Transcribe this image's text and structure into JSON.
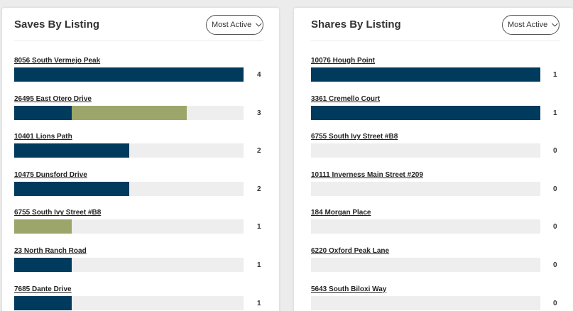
{
  "colors": {
    "primary": "#003a5d",
    "secondary": "#9ca66a",
    "track": "#eeeeee"
  },
  "saves": {
    "title": "Saves By Listing",
    "dropdown": "Most Active",
    "max": 4,
    "items": [
      {
        "label": "8056 South Vermejo Peak",
        "count": "4",
        "primary": 4,
        "secondary": 0
      },
      {
        "label": "26495 East Otero Drive",
        "count": "3",
        "primary": 1,
        "secondary": 2
      },
      {
        "label": "10401 Lions Path",
        "count": "2",
        "primary": 2,
        "secondary": 0
      },
      {
        "label": "10475 Dunsford Drive",
        "count": "2",
        "primary": 2,
        "secondary": 0
      },
      {
        "label": "6755 South Ivy Street #B8",
        "count": "1",
        "primary": 0,
        "secondary": 1
      },
      {
        "label": "23 North Ranch Road",
        "count": "1",
        "primary": 1,
        "secondary": 0
      },
      {
        "label": "7685 Dante Drive",
        "count": "1",
        "primary": 1,
        "secondary": 0
      }
    ]
  },
  "shares": {
    "title": "Shares By Listing",
    "dropdown": "Most Active",
    "max": 1,
    "items": [
      {
        "label": "10076 Hough Point",
        "count": "1",
        "primary": 1,
        "secondary": 0
      },
      {
        "label": "3361 Cremello Court",
        "count": "1",
        "primary": 1,
        "secondary": 0
      },
      {
        "label": "6755 South Ivy Street #B8",
        "count": "0",
        "primary": 0,
        "secondary": 0
      },
      {
        "label": "10111 Inverness Main Street #209",
        "count": "0",
        "primary": 0,
        "secondary": 0
      },
      {
        "label": "184 Morgan Place",
        "count": "0",
        "primary": 0,
        "secondary": 0
      },
      {
        "label": "6220 Oxford Peak Lane",
        "count": "0",
        "primary": 0,
        "secondary": 0
      },
      {
        "label": "5643 South Biloxi Way",
        "count": "0",
        "primary": 0,
        "secondary": 0
      }
    ]
  }
}
